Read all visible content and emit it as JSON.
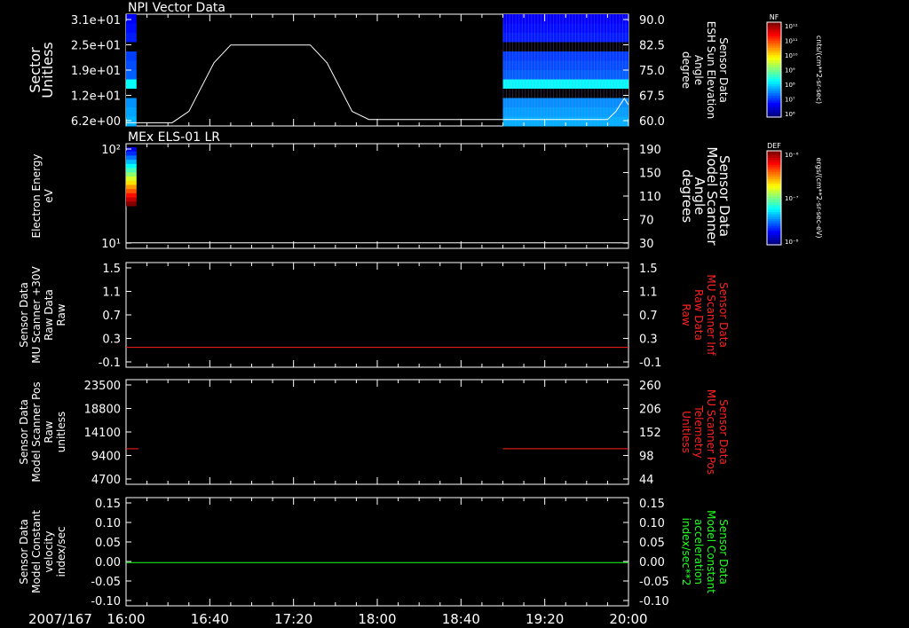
{
  "date_label": "2007/167",
  "time_ticks": [
    "16:00",
    "16:40",
    "17:20",
    "18:00",
    "18:40",
    "19:20",
    "20:00"
  ],
  "colorbars": [
    {
      "name": "NF",
      "unit": "cnts/(cm**2-sr-sec)",
      "ticks": [
        "10¹²",
        "10¹¹",
        "10¹⁰",
        "10⁹",
        "10⁸",
        "10⁷",
        "10⁶"
      ]
    },
    {
      "name": "DEF",
      "unit": "ergs/(cm**2-sr-sec-eV)",
      "ticks": [
        "10⁻⁶",
        "10⁻⁷",
        "10⁻⁸"
      ]
    }
  ],
  "chart_data": [
    {
      "type": "heatmap",
      "title": "NPI Vector Data",
      "ylabel": [
        "Sector",
        "Unitless"
      ],
      "yticks": [
        "3.1e+01",
        "2.5e+01",
        "1.9e+01",
        "1.2e+01",
        "6.2e+00"
      ],
      "y2label": [
        "Sensor Data",
        "ESH Sun Elevation",
        "Angle",
        "degree"
      ],
      "y2ticks": [
        "90.0",
        "82.5",
        "75.0",
        "67.5",
        "60.0"
      ],
      "y2lim": [
        55.5,
        90
      ],
      "overlay_line": {
        "color": "#ffffff",
        "x": [
          "16:00",
          "16:22",
          "16:30",
          "16:42",
          "16:50",
          "17:28",
          "17:36",
          "17:48",
          "17:56",
          "19:50",
          "19:54",
          "19:58",
          "20:00"
        ],
        "y": [
          56.5,
          56.5,
          60,
          75,
          80.5,
          80.5,
          75,
          60,
          57.5,
          57.5,
          60,
          64,
          62
        ]
      },
      "data_blocks": [
        {
          "x_start": "16:00",
          "x_end": "16:05"
        },
        {
          "x_start": "19:00",
          "x_end": "20:00"
        }
      ]
    },
    {
      "type": "heatmap",
      "title": "MEx ELS-01 LR",
      "ylabel": [
        "Electron Energy",
        "eV"
      ],
      "yticks": [
        "10²",
        "10¹"
      ],
      "y2label": [
        "Sensor Data",
        "Model Scanner",
        "Angle",
        "degrees"
      ],
      "y2ticks": [
        "190",
        "150",
        "110",
        "70",
        "30"
      ],
      "y2lim": [
        0,
        190
      ],
      "overlay_line": {
        "color": "#ffffff",
        "x": [
          "16:00",
          "20:00"
        ],
        "y": [
          10,
          10
        ]
      },
      "data_blocks": [
        {
          "x_start": "16:00",
          "x_end": "16:05"
        }
      ]
    },
    {
      "type": "line",
      "ylabel": [
        "Sensor Data",
        "MU Scanner +30V",
        "Raw Data",
        "Raw"
      ],
      "yticks": [
        "1.5",
        "1.1",
        "0.7",
        "0.3",
        "-0.1"
      ],
      "ylim": [
        -0.35,
        1.5
      ],
      "y2label": [
        "Sensor Data",
        "MU Scanner Inf",
        "Raw Data",
        "Raw"
      ],
      "y2label_color": "#ff2020",
      "y2ticks": [
        "1.5",
        "1.1",
        "0.7",
        "0.3",
        "-0.1"
      ],
      "series": [
        {
          "color": "#ff2020",
          "x": [
            "16:00",
            "20:00"
          ],
          "y": [
            0,
            0
          ]
        }
      ]
    },
    {
      "type": "line",
      "ylabel": [
        "Sensor Data",
        "Model Scanner Pos",
        "Raw",
        "unitless"
      ],
      "yticks": [
        "23500",
        "18800",
        "14100",
        "9400",
        "4700"
      ],
      "ylim": [
        0,
        23500
      ],
      "y2label": [
        "Sensor Data",
        "MU Scanner Pos",
        "Telemetry",
        "Unitless"
      ],
      "y2label_color": "#ff2020",
      "y2ticks": [
        "260",
        "206",
        "152",
        "98",
        "44"
      ],
      "series": [
        {
          "color": "#ff2020",
          "x": [
            "16:00",
            "16:06"
          ],
          "y": [
            7980,
            7980
          ]
        },
        {
          "color": "#ff2020",
          "x": [
            "19:00",
            "20:00"
          ],
          "y": [
            7980,
            7980
          ]
        }
      ]
    },
    {
      "type": "line",
      "ylabel": [
        "Sensor Data",
        "Model Constant",
        "velocity",
        "index/sec"
      ],
      "yticks": [
        "0.15",
        "0.10",
        "0.05",
        "0.00",
        "-0.05",
        "-0.10"
      ],
      "ylim": [
        -0.1,
        0.15
      ],
      "y2label": [
        "Sensor Data",
        "Model Constant",
        "acceleration",
        "index/sec**2"
      ],
      "y2label_color": "#20ff20",
      "y2ticks": [
        "0.15",
        "0.10",
        "0.05",
        "0.00",
        "-0.05",
        "-0.10"
      ],
      "series": [
        {
          "color": "#20ff20",
          "x": [
            "16:00",
            "20:00"
          ],
          "y": [
            0,
            0
          ]
        }
      ]
    }
  ]
}
